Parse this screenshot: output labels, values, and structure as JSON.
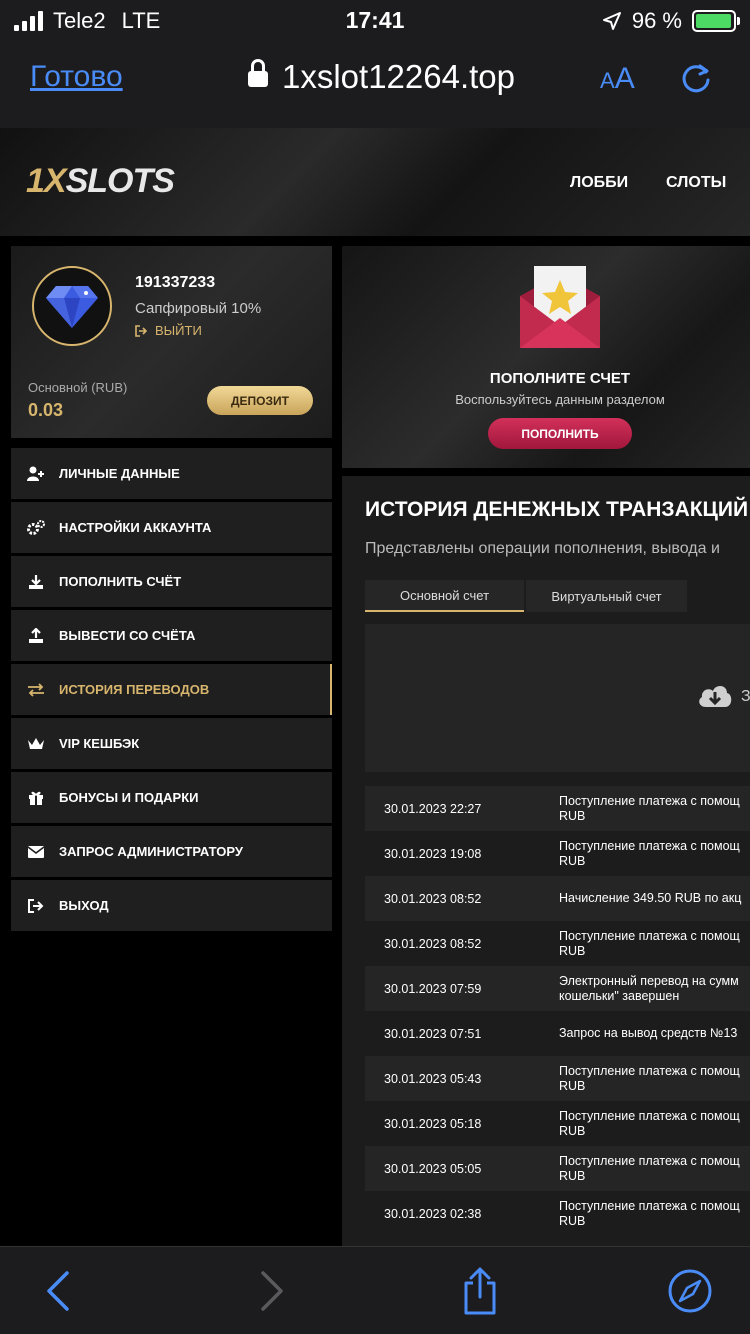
{
  "status_bar": {
    "carrier": "Tele2",
    "network": "LTE",
    "time": "17:41",
    "battery": "96 %",
    "battery_level": 0.96
  },
  "browser": {
    "done_label": "Готово",
    "url": "1xslot12264.top",
    "text_size_label_small": "A",
    "text_size_label_large": "A"
  },
  "site": {
    "logo_prefix": "1X",
    "logo_suffix": "SLOTS",
    "nav": {
      "lobby": "ЛОББИ",
      "slots": "СЛОТЫ"
    }
  },
  "profile": {
    "user_id": "191337233",
    "level": "Сапфировый 10%",
    "logout": "ВЫЙТИ",
    "balance_label": "Основной (RUB)",
    "balance_value": "0.03",
    "deposit_button": "ДЕПОЗИТ"
  },
  "menu": {
    "items": [
      {
        "label": "ЛИЧНЫЕ ДАННЫЕ",
        "icon": "user-add-icon"
      },
      {
        "label": "НАСТРОЙКИ АККАУНТА",
        "icon": "gears-icon"
      },
      {
        "label": "ПОПОЛНИТЬ СЧЁТ",
        "icon": "download-icon"
      },
      {
        "label": "ВЫВЕСТИ СО СЧЁТА",
        "icon": "upload-icon"
      },
      {
        "label": "ИСТОРИЯ ПЕРЕВОДОВ",
        "icon": "transfer-arrows-icon",
        "active": true
      },
      {
        "label": "VIP КЕШБЭК",
        "icon": "crown-icon"
      },
      {
        "label": "БОНУСЫ И ПОДАРКИ",
        "icon": "gift-icon"
      },
      {
        "label": "ЗАПРОС АДМИНИСТРАТОРУ",
        "icon": "envelope-icon"
      },
      {
        "label": "ВЫХОД",
        "icon": "exit-icon"
      }
    ]
  },
  "promo": {
    "title": "ПОПОЛНИТЕ СЧЕТ",
    "subtitle": "Воспользуйтесь данным разделом",
    "button": "ПОПОЛНИТЬ"
  },
  "history": {
    "title": "ИСТОРИЯ ДЕНЕЖНЫХ ТРАНЗАКЦИЙ",
    "subtitle": "Представлены операции пополнения, вывода и",
    "tabs": [
      "Основной счет",
      "Виртуальный счет"
    ],
    "cloud_text": "З",
    "rows": [
      {
        "date": "30.01.2023 22:27",
        "desc": "Поступление платежа с помощ\nRUB"
      },
      {
        "date": "30.01.2023 19:08",
        "desc": "Поступление платежа с помощ\nRUB"
      },
      {
        "date": "30.01.2023 08:52",
        "desc": "Начисление 349.50 RUB по акц"
      },
      {
        "date": "30.01.2023 08:52",
        "desc": "Поступление платежа с помощ\nRUB"
      },
      {
        "date": "30.01.2023 07:59",
        "desc": "Электронный перевод на сумм\nкошельки\" завершен"
      },
      {
        "date": "30.01.2023 07:51",
        "desc": "Запрос на вывод средств №13"
      },
      {
        "date": "30.01.2023 05:43",
        "desc": "Поступление платежа с помощ\nRUB"
      },
      {
        "date": "30.01.2023 05:18",
        "desc": "Поступление платежа с помощ\nRUB"
      },
      {
        "date": "30.01.2023 05:05",
        "desc": "Поступление платежа с помощ\nRUB"
      },
      {
        "date": "30.01.2023 02:38",
        "desc": "Поступление платежа с помощ\nRUB"
      }
    ]
  },
  "colors": {
    "gold": "#d7b56d",
    "pink": "#c0244d",
    "ios_blue": "#4a8cf7"
  }
}
